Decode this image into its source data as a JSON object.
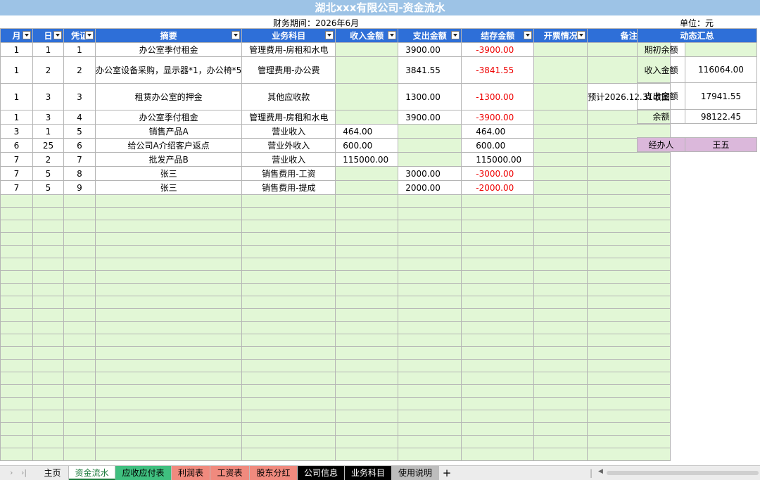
{
  "title": "湖北xxx有限公司-资金流水",
  "period": "财务期间：2026年6月",
  "unit": "单位：元",
  "headers": [
    "月",
    "日",
    "凭证",
    "摘要",
    "业务科目",
    "收入金额",
    "支出金额",
    "结存金额",
    "开票情况",
    "备注"
  ],
  "rows": [
    [
      "1",
      "1",
      "1",
      "办公室季付租金",
      "管理费用-房租和水电",
      "",
      "3900.00",
      "-3900.00",
      "",
      ""
    ],
    [
      "1",
      "2",
      "2",
      "办公室设备采购，显示器*1，办公椅*5",
      "管理费用-办公费",
      "",
      "3841.55",
      "-3841.55",
      "",
      ""
    ],
    [
      "1",
      "3",
      "3",
      "租赁办公室的押金",
      "其他应收款",
      "",
      "1300.00",
      "-1300.00",
      "",
      "预计2026.12.31收回"
    ],
    [
      "1",
      "3",
      "4",
      "办公室季付租金",
      "管理费用-房租和水电",
      "",
      "3900.00",
      "-3900.00",
      "",
      ""
    ],
    [
      "3",
      "1",
      "5",
      "销售产品A",
      "营业收入",
      "464.00",
      "",
      "464.00",
      "",
      ""
    ],
    [
      "6",
      "25",
      "6",
      "给公司A介绍客户返点",
      "营业外收入",
      "600.00",
      "",
      "600.00",
      "",
      ""
    ],
    [
      "7",
      "2",
      "7",
      "批发产品B",
      "营业收入",
      "115000.00",
      "",
      "115000.00",
      "",
      ""
    ],
    [
      "7",
      "5",
      "8",
      "张三",
      "销售费用-工资",
      "",
      "3000.00",
      "-3000.00",
      "",
      ""
    ],
    [
      "7",
      "5",
      "9",
      "张三",
      "销售费用-提成",
      "",
      "2000.00",
      "-2000.00",
      "",
      ""
    ]
  ],
  "summary": {
    "header": "动态汇总",
    "items": [
      {
        "label": "期初余额",
        "value": ""
      },
      {
        "label": "收入金额",
        "value": "116064.00"
      },
      {
        "label": "支出金额",
        "value": "17941.55"
      },
      {
        "label": "余额",
        "value": "98122.45"
      }
    ],
    "handler_label": "经办人",
    "handler_value": "王五"
  },
  "tabs": [
    {
      "label": "主页",
      "color": "#ececec",
      "text_color": "#000000"
    },
    {
      "label": "资金流水",
      "color": "#ffffff",
      "text_color": "#1a7a3a"
    },
    {
      "label": "应收应付表",
      "color": "#3fbf7f",
      "text_color": "#000000"
    },
    {
      "label": "利润表",
      "color": "#f08a7e",
      "text_color": "#000000"
    },
    {
      "label": "工资表",
      "color": "#f08a7e",
      "text_color": "#000000"
    },
    {
      "label": "股东分红",
      "color": "#f08a7e",
      "text_color": "#000000"
    },
    {
      "label": "公司信息",
      "color": "#000000",
      "text_color": "#ffffff"
    },
    {
      "label": "业务科目",
      "color": "#000000",
      "text_color": "#ffffff"
    },
    {
      "label": "使用说明",
      "color": "#bdbdbd",
      "text_color": "#000000"
    }
  ],
  "add_tab": "+",
  "colors": {
    "header_blue": "#2e6fd8",
    "title_blue": "#9dc3e6",
    "entry_green": "#e2f7d6",
    "negative_red": "#e00000",
    "handler_pink": "#dbb8db"
  }
}
